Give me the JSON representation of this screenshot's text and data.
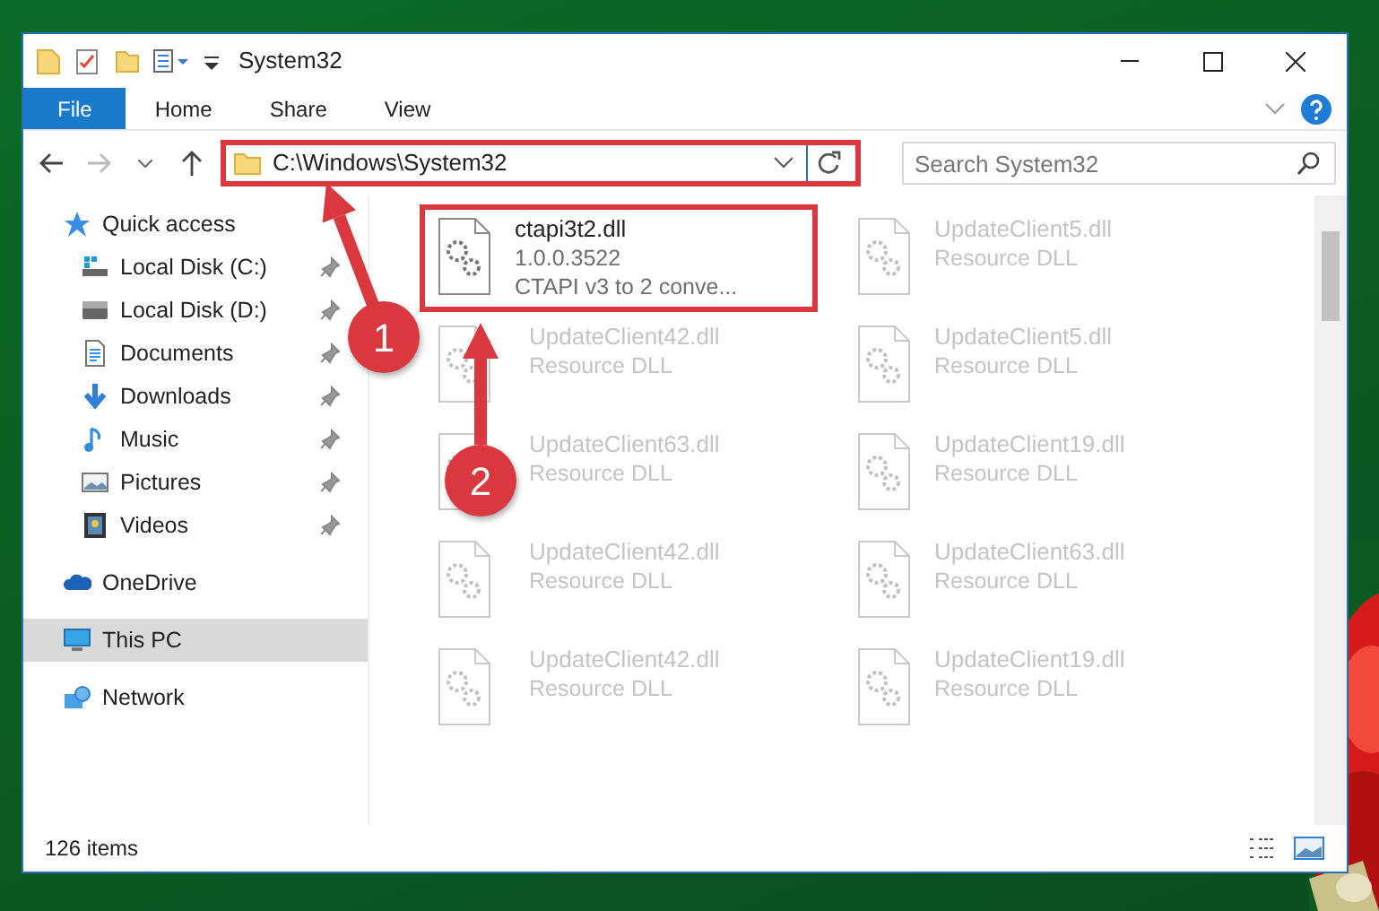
{
  "window": {
    "title": "System32"
  },
  "ribbon": {
    "tabs": [
      {
        "label": "File",
        "kind": "file"
      },
      {
        "label": "Home",
        "kind": "tab"
      },
      {
        "label": "Share",
        "kind": "tab"
      },
      {
        "label": "View",
        "kind": "tab"
      }
    ]
  },
  "address": {
    "path": "C:\\Windows\\System32",
    "highlighted": true
  },
  "search": {
    "placeholder": "Search System32"
  },
  "navigation": [
    {
      "label": "Quick access",
      "kind": "star",
      "selected": false,
      "children": [
        {
          "label": "Local Disk (C:)",
          "kind": "system-drive",
          "pinned": true
        },
        {
          "label": "Local Disk (D:)",
          "kind": "drive",
          "pinned": true
        },
        {
          "label": "Documents",
          "kind": "documents",
          "pinned": true
        },
        {
          "label": "Downloads",
          "kind": "downloads",
          "pinned": true
        },
        {
          "label": "Music",
          "kind": "music",
          "pinned": true
        },
        {
          "label": "Pictures",
          "kind": "pictures",
          "pinned": true
        },
        {
          "label": "Videos",
          "kind": "videos",
          "pinned": true
        }
      ]
    },
    {
      "label": "OneDrive",
      "kind": "cloud",
      "selected": false
    },
    {
      "label": "This PC",
      "kind": "pc",
      "selected": true
    },
    {
      "label": "Network",
      "kind": "network",
      "selected": false
    }
  ],
  "files": [
    {
      "name": "ctapi3t2.dll",
      "details": [
        "1.0.0.3522",
        "CTAPI v3 to 2 conve..."
      ],
      "highlighted": true,
      "blurred": false
    },
    {
      "name": "UpdateClient5.dll",
      "details": [
        "Resource DLL"
      ],
      "highlighted": false,
      "blurred": true
    },
    {
      "name": "UpdateClient42.dll",
      "details": [
        "Resource DLL"
      ],
      "highlighted": false,
      "blurred": true
    },
    {
      "name": "UpdateClient5.dll",
      "details": [
        "Resource DLL"
      ],
      "highlighted": false,
      "blurred": true
    },
    {
      "name": "UpdateClient63.dll",
      "details": [
        "Resource DLL"
      ],
      "highlighted": false,
      "blurred": true
    },
    {
      "name": "UpdateClient19.dll",
      "details": [
        "Resource DLL"
      ],
      "highlighted": false,
      "blurred": true
    },
    {
      "name": "UpdateClient42.dll",
      "details": [
        "Resource DLL"
      ],
      "highlighted": false,
      "blurred": true
    },
    {
      "name": "UpdateClient63.dll",
      "details": [
        "Resource DLL"
      ],
      "highlighted": false,
      "blurred": true
    },
    {
      "name": "UpdateClient42.dll",
      "details": [
        "Resource DLL"
      ],
      "highlighted": false,
      "blurred": true
    },
    {
      "name": "UpdateClient19.dll",
      "details": [
        "Resource DLL"
      ],
      "highlighted": false,
      "blurred": true
    }
  ],
  "annotations": [
    {
      "label": "1"
    },
    {
      "label": "2"
    }
  ],
  "status_bar": {
    "count": "126 items"
  }
}
